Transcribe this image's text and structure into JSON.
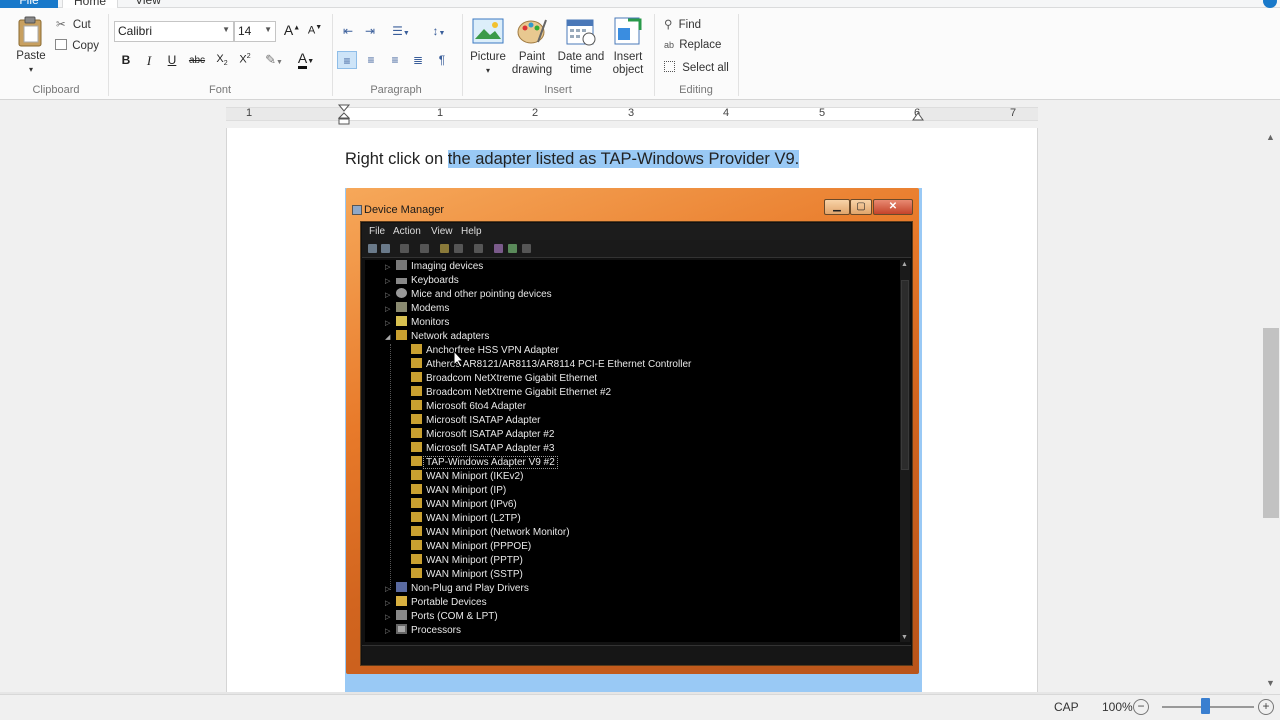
{
  "ribbon_tabs": {
    "file": "File",
    "home": "Home",
    "view": "View"
  },
  "clipboard": {
    "paste": "Paste",
    "cut": "Cut",
    "copy": "Copy",
    "label": "Clipboard"
  },
  "font": {
    "family": "Calibri",
    "size": "14",
    "label": "Font"
  },
  "paragraph": {
    "label": "Paragraph"
  },
  "insert": {
    "picture": "Picture",
    "paint_drawing": "Paint drawing",
    "date_time": "Date and time",
    "insert_object": "Insert object",
    "label": "Insert"
  },
  "editing": {
    "find": "Find",
    "replace": "Replace",
    "select_all": "Select all",
    "label": "Editing"
  },
  "ruler": {
    "numbers": [
      "1",
      "1",
      "2",
      "3",
      "4",
      "5",
      "6",
      "7"
    ]
  },
  "document": {
    "text_before": "Right click on ",
    "text_selected": "the adapter listed as TAP-Windows Provider V9."
  },
  "device_manager": {
    "title": "Device Manager",
    "menu": [
      "File",
      "Action",
      "View",
      "Help"
    ],
    "categories_top": [
      "Imaging devices",
      "Keyboards",
      "Mice and other pointing devices",
      "Modems",
      "Monitors",
      "Network adapters"
    ],
    "network_adapters": [
      "Anchorfree HSS VPN Adapter",
      "Atheros AR8121/AR8113/AR8114 PCI-E Ethernet Controller",
      "Broadcom NetXtreme Gigabit Ethernet",
      "Broadcom NetXtreme Gigabit Ethernet #2",
      "Microsoft 6to4 Adapter",
      "Microsoft ISATAP Adapter",
      "Microsoft ISATAP Adapter #2",
      "Microsoft ISATAP Adapter #3",
      "TAP-Windows Adapter V9 #2",
      "WAN Miniport (IKEv2)",
      "WAN Miniport (IP)",
      "WAN Miniport (IPv6)",
      "WAN Miniport (L2TP)",
      "WAN Miniport (Network Monitor)",
      "WAN Miniport (PPPOE)",
      "WAN Miniport (PPTP)",
      "WAN Miniport (SSTP)"
    ],
    "categories_bottom": [
      "Non-Plug and Play Drivers",
      "Portable Devices",
      "Ports (COM & LPT)",
      "Processors"
    ]
  },
  "status": {
    "caps": "CAP",
    "zoom": "100%"
  },
  "colors": {
    "accent": "#1979ca",
    "selection": "#99c9f5"
  }
}
